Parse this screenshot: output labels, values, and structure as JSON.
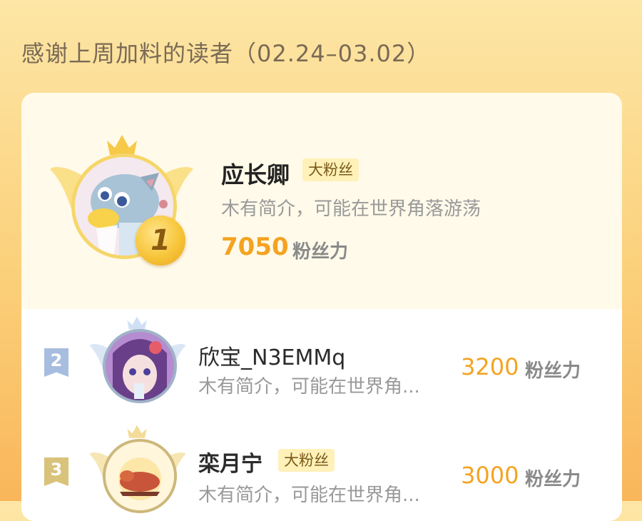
{
  "header": {
    "title": "感谢上周加料的读者（02.24–03.02）"
  },
  "ranking": [
    {
      "rank": "1",
      "name": "应长卿",
      "badge": "大粉丝",
      "bio": "木有简介，可能在世界角落游荡",
      "fans_value": "7050",
      "fans_unit": "粉丝力",
      "medal_color": "#f4b629"
    },
    {
      "rank": "2",
      "name": "欣宝_N3EMMq",
      "badge": "",
      "bio": "木有简介，可能在世界角...",
      "fans_value": "3200",
      "fans_unit": "粉丝力",
      "tag_color": "#a7bde0"
    },
    {
      "rank": "3",
      "name": "栾月宁",
      "badge": "大粉丝",
      "bio": "木有简介，可能在世界角...",
      "fans_value": "3000",
      "fans_unit": "粉丝力",
      "tag_color": "#d9c27a"
    }
  ],
  "colors": {
    "accent": "#f4a321",
    "card_bg": "#fffaea",
    "badge_bg": "#fff1b8"
  },
  "icons": [
    "crown-icon",
    "wings-icon",
    "rank-medal-icon",
    "rank-tag-icon"
  ]
}
